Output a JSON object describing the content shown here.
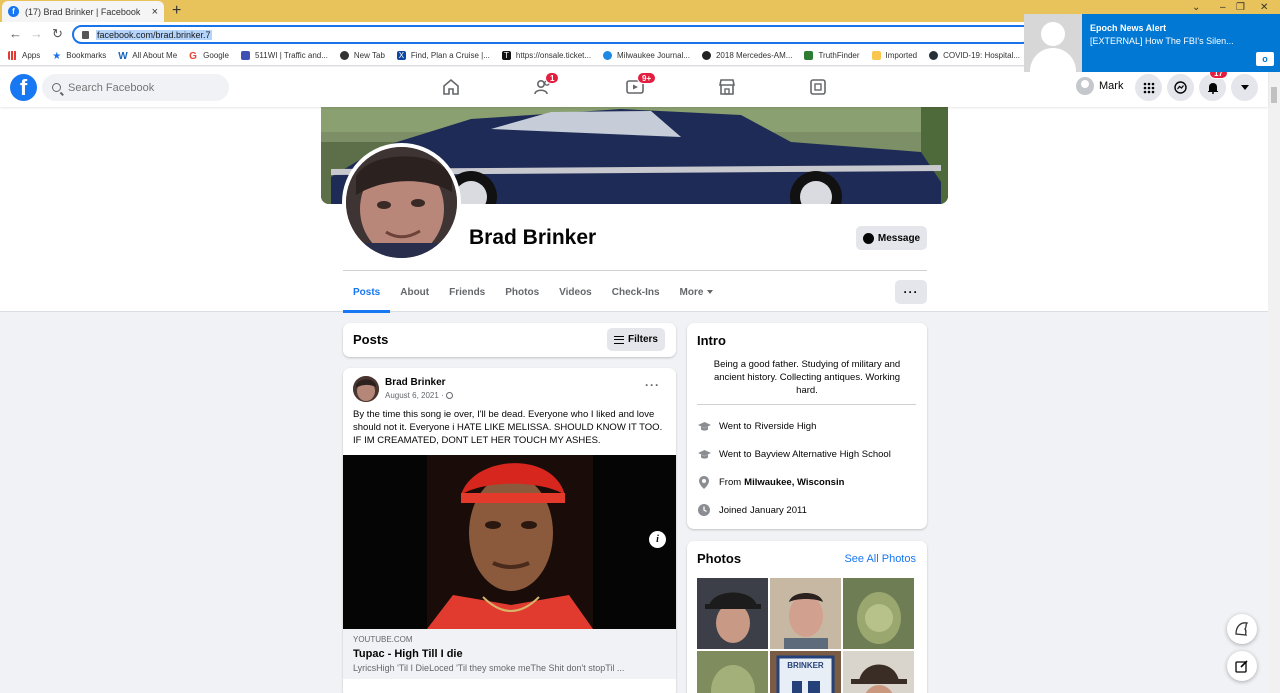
{
  "browser": {
    "tab_title": "(17) Brad Brinker | Facebook",
    "tab_close": "×",
    "new_tab": "+",
    "url": "facebook.com/brad.brinker.7",
    "bookmarks": [
      "Apps",
      "Bookmarks",
      "All About Me",
      "Google",
      "511WI | Traffic and...",
      "New Tab",
      "Find, Plan a Cruise |...",
      "https://onsale.ticket...",
      "Milwaukee Journal...",
      "2018 Mercedes-AM...",
      "TruthFinder",
      "Imported",
      "COVID-19: Hospital..."
    ],
    "colors": {
      "tabstrip": "#e8c25a",
      "accent": "#1a73e8"
    }
  },
  "notification": {
    "title": "Epoch News Alert",
    "text": "[EXTERNAL] How The FBI's Silen...",
    "app_icon": "outlook-icon",
    "app_badge": "o"
  },
  "header": {
    "logo": "f",
    "search_placeholder": "Search Facebook",
    "nav": [
      {
        "icon": "home-icon",
        "badge": ""
      },
      {
        "icon": "friends-icon",
        "badge": "1"
      },
      {
        "icon": "watch-icon",
        "badge": "9+"
      },
      {
        "icon": "marketplace-icon",
        "badge": ""
      },
      {
        "icon": "gaming-icon",
        "badge": ""
      }
    ],
    "user_name": "Mark",
    "notifications_badge": "17",
    "colors": {
      "brand": "#1877f2",
      "badge": "#e41e3f"
    }
  },
  "profile": {
    "name": "Brad Brinker",
    "message_label": "Message",
    "tabs": [
      "Posts",
      "About",
      "Friends",
      "Photos",
      "Videos",
      "Check-Ins",
      "More"
    ],
    "active_tab": "Posts",
    "more_options": "···"
  },
  "posts_section": {
    "title": "Posts",
    "filters_label": "Filters"
  },
  "post": {
    "author": "Brad Brinker",
    "date": "August 6, 2021 ·",
    "text": "By the time this song ie over, I'll be dead. Everyone who I liked and love should not it. Everyone i HATE LIKE MELISSA. SHOULD KNOW IT TOO. IF IM CREAMATED, DONT LET HER TOUCH MY ASHES.",
    "link_domain": "YOUTUBE.COM",
    "link_title": "Tupac - High Till I die",
    "link_desc": "LyricsHigh 'Til I DieLoced 'Til they smoke meThe Shit don't stopTil ...",
    "more": "···",
    "info": "i"
  },
  "intro": {
    "title": "Intro",
    "bio": "Being a good father. Studying of military and ancient history. Collecting antiques. Working hard.",
    "items": [
      {
        "icon": "graduation-cap-icon",
        "prefix": "Went to ",
        "value": "Riverside High"
      },
      {
        "icon": "graduation-cap-icon",
        "prefix": "Went to ",
        "value": "Bayview Alternative High School"
      },
      {
        "icon": "location-pin-icon",
        "prefix": "From ",
        "value": "Milwaukee, Wisconsin"
      },
      {
        "icon": "clock-icon",
        "prefix": "Joined ",
        "value": "January 2011"
      }
    ]
  },
  "photos": {
    "title": "Photos",
    "see_all": "See All Photos",
    "jersey_text": "BRINKER"
  }
}
